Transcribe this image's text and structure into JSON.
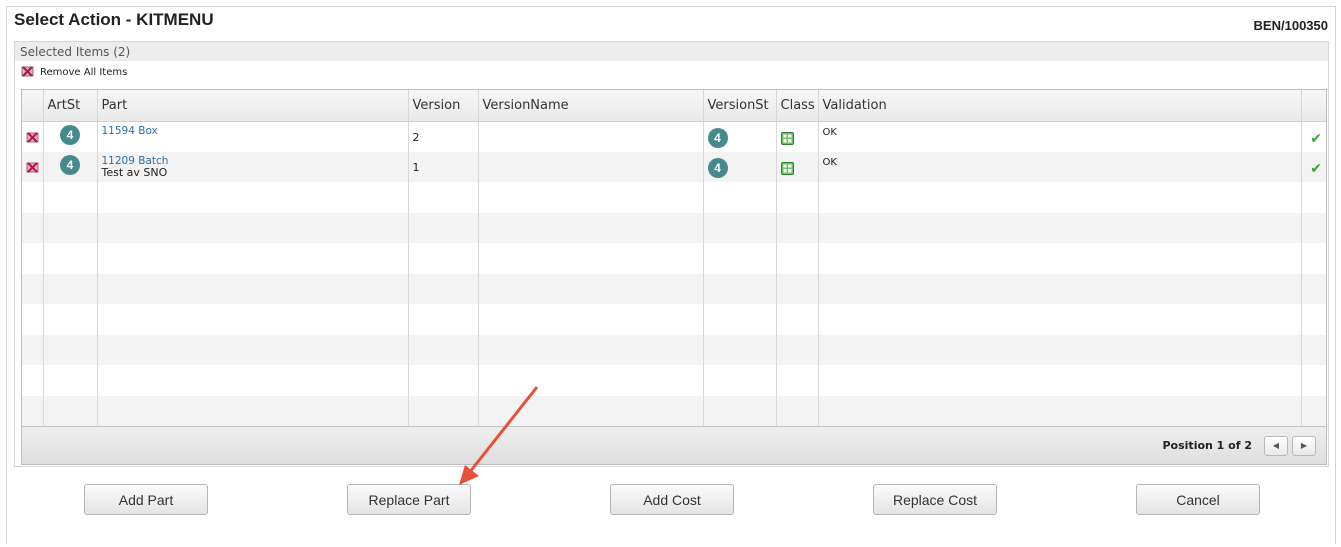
{
  "header": {
    "title": "Select Action - KITMENU",
    "ref": "BEN/100350"
  },
  "selection": {
    "heading": "Selected Items (2)",
    "remove_all_label": "Remove All Items"
  },
  "table": {
    "columns": [
      "",
      "ArtSt",
      "Part",
      "Version",
      "VersionName",
      "VersionSt",
      "Class",
      "Validation",
      ""
    ],
    "rows": [
      {
        "art_st": "4",
        "part_number": "11594 Box",
        "part_desc": "",
        "version": "2",
        "version_name": "",
        "version_st": "4",
        "validation": "OK"
      },
      {
        "art_st": "4",
        "part_number": "11209 Batch",
        "part_desc": "Test av SNO",
        "version": "1",
        "version_name": "",
        "version_st": "4",
        "validation": "OK"
      }
    ]
  },
  "pager": {
    "position_text": "Position 1 of 2",
    "prev_icon": "triangle-left-icon",
    "next_icon": "triangle-right-icon"
  },
  "buttons": {
    "add_part": "Add Part",
    "replace_part": "Replace Part",
    "add_cost": "Add Cost",
    "replace_cost": "Replace Cost",
    "cancel": "Cancel"
  },
  "colors": {
    "badge": "#478a8e",
    "link": "#2a6ea8",
    "check": "#3aa535",
    "arrow": "#e8503a"
  }
}
